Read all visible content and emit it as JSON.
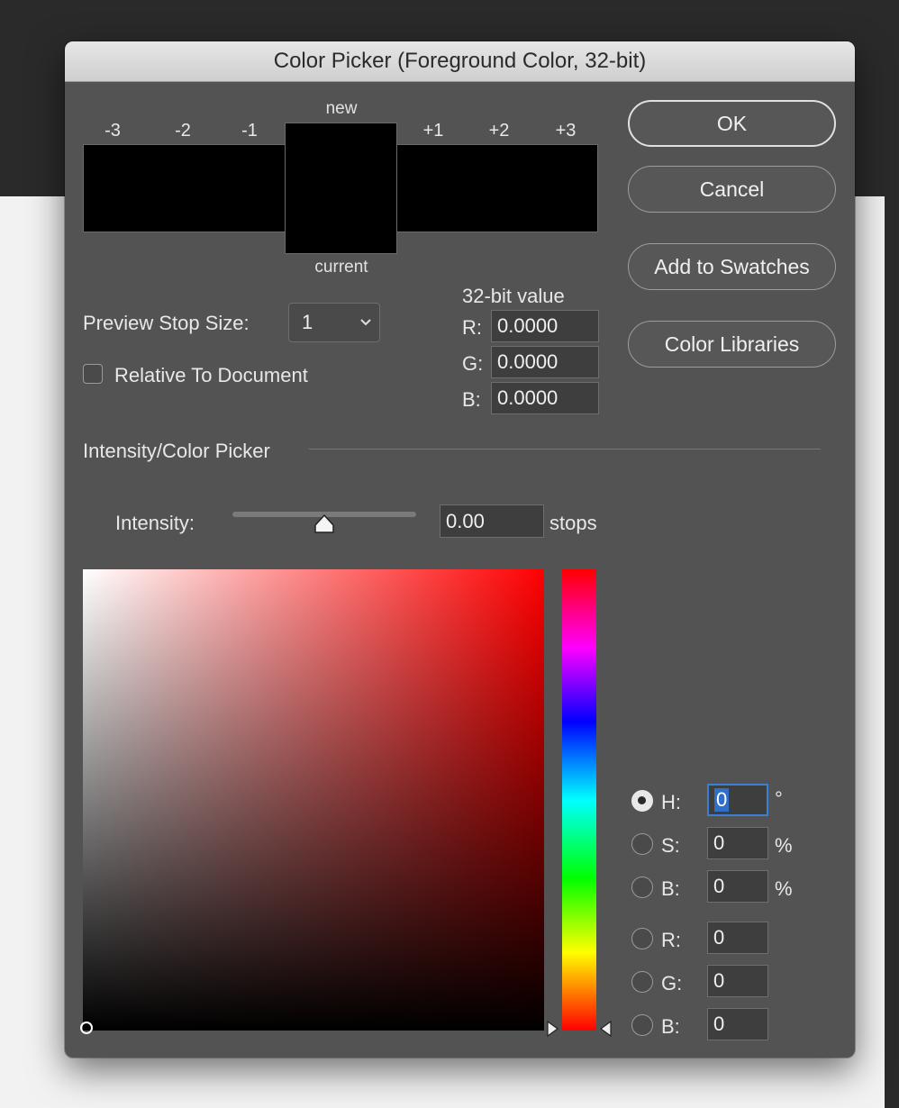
{
  "dialog": {
    "title": "Color Picker (Foreground Color, 32-bit)"
  },
  "preview": {
    "stop_labels": [
      "-3",
      "-2",
      "-1",
      "+1",
      "+2",
      "+3"
    ],
    "new_label": "new",
    "current_label": "current",
    "stop_size_label": "Preview Stop Size:",
    "stop_size_value": "1",
    "relative_label": "Relative To Document",
    "relative_checked": false
  },
  "buttons": {
    "ok": "OK",
    "cancel": "Cancel",
    "add_to_swatches": "Add to Swatches",
    "color_libraries": "Color Libraries"
  },
  "value32": {
    "heading": "32-bit value",
    "r_label": "R:",
    "r": "0.0000",
    "g_label": "G:",
    "g": "0.0000",
    "b_label": "B:",
    "b": "0.0000"
  },
  "intensity": {
    "section_title": "Intensity/Color Picker",
    "label": "Intensity:",
    "value": "0.00",
    "unit": "stops",
    "slider_level": 0.5
  },
  "hsb": {
    "h_label": "H:",
    "h": "0",
    "h_unit": "°",
    "s_label": "S:",
    "s": "0",
    "s_unit": "%",
    "b_label": "B:",
    "b": "0",
    "b_unit": "%",
    "selected": "H"
  },
  "rgb": {
    "r_label": "R:",
    "r": "0",
    "g_label": "G:",
    "g": "0",
    "b_label": "B:",
    "b": "0"
  },
  "colors": {
    "hue_color": "#ff0000",
    "new_color": "#000000",
    "current_color": "#000000"
  }
}
